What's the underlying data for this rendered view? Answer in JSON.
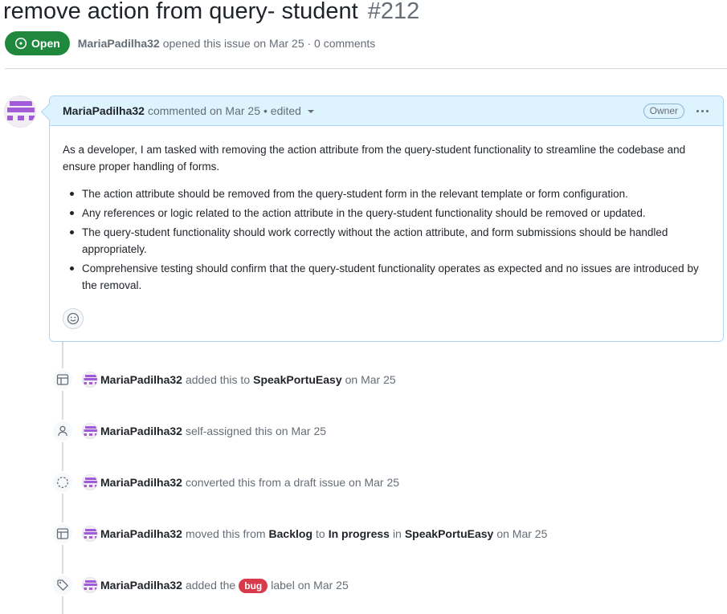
{
  "issue": {
    "title": "remove action from query- student",
    "number": "#212",
    "state": "Open",
    "author": "MariaPadilha32",
    "opened_text": "opened this issue on Mar 25 · 0 comments"
  },
  "comment": {
    "author": "MariaPadilha32",
    "commented_text": "commented on Mar 25",
    "edited_text": "• edited",
    "owner_badge": "Owner",
    "body_intro": "As a developer, I am tasked with removing the action attribute from the query-student functionality to streamline the codebase and ensure proper handling of forms.",
    "bullets": [
      "The action attribute should be removed from the query-student form in the relevant template or form configuration.",
      "Any references or logic related to the action attribute in the query-student functionality should be removed or updated.",
      "The query-student functionality should work correctly without the action attribute, and form submissions should be handled appropriately.",
      "Comprehensive testing should confirm that the query-student functionality operates as expected and no issues are introduced by the removal."
    ]
  },
  "timeline": [
    {
      "icon": "project-table-icon",
      "actor": "MariaPadilha32",
      "text1": "added this to",
      "strong1": "SpeakPortuEasy",
      "text2": "on Mar 25"
    },
    {
      "icon": "person-icon",
      "actor": "MariaPadilha32",
      "text1": "self-assigned this on Mar 25"
    },
    {
      "icon": "draft-issue-icon",
      "actor": "MariaPadilha32",
      "text1": "converted this from a draft issue on Mar 25"
    },
    {
      "icon": "project-table-icon",
      "actor": "MariaPadilha32",
      "text1": "moved this from",
      "strong1": "Backlog",
      "text2": "to",
      "strong2": "In progress",
      "text3": "in",
      "strong3": "SpeakPortuEasy",
      "text4": "on Mar 25"
    },
    {
      "icon": "tag-icon",
      "actor": "MariaPadilha32",
      "text1": "added the",
      "label": "bug",
      "text2": "label on Mar 25"
    }
  ],
  "colors": {
    "open_green": "#1f883d",
    "header_blue": "#ddf4ff",
    "bug_label": "#d73a4a",
    "avatar_purple": "#a35cd8"
  }
}
